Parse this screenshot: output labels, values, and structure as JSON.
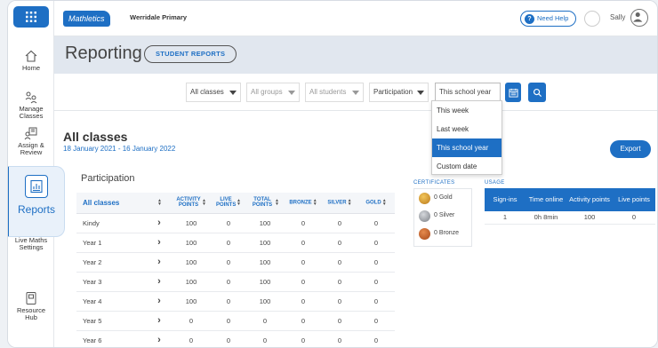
{
  "app": {
    "logo": "Mathletics",
    "school": "Werridale Primary",
    "need_help": "Need Help",
    "user": "Sally"
  },
  "sidebar": {
    "items": [
      {
        "label": "Home",
        "icon": "home-icon"
      },
      {
        "label": "Manage Classes",
        "icon": "manage-classes-icon"
      },
      {
        "label": "Assign & Review",
        "icon": "assign-review-icon"
      },
      {
        "label": "Reports",
        "icon": "reports-icon"
      },
      {
        "label": "Live Maths Settings",
        "icon": "live-maths-icon"
      },
      {
        "label": "Resource Hub",
        "icon": "resource-hub-icon"
      }
    ]
  },
  "header": {
    "title": "Reporting",
    "student_reports": "STUDENT REPORTS"
  },
  "filters": {
    "classes": "All classes",
    "groups": "All groups",
    "students": "All students",
    "type": "Participation",
    "period": "This school year"
  },
  "dropdown": {
    "options": [
      "This week",
      "Last week",
      "This school year",
      "Custom date"
    ],
    "selected": "This school year"
  },
  "summary": {
    "heading": "All classes",
    "date_range": "18 January 2021 - 16 January 2022",
    "export": "Export"
  },
  "participation": {
    "title": "Participation",
    "columns": [
      "All classes",
      "ACTIVITY POINTS",
      "LIVE POINTS",
      "TOTAL POINTS",
      "BRONZE",
      "SILVER",
      "GOLD"
    ],
    "rows": [
      {
        "name": "Kindy",
        "activity": "100",
        "live": "0",
        "total": "100",
        "bronze": "0",
        "silver": "0",
        "gold": "0"
      },
      {
        "name": "Year 1",
        "activity": "100",
        "live": "0",
        "total": "100",
        "bronze": "0",
        "silver": "0",
        "gold": "0"
      },
      {
        "name": "Year 2",
        "activity": "100",
        "live": "0",
        "total": "100",
        "bronze": "0",
        "silver": "0",
        "gold": "0"
      },
      {
        "name": "Year 3",
        "activity": "100",
        "live": "0",
        "total": "100",
        "bronze": "0",
        "silver": "0",
        "gold": "0"
      },
      {
        "name": "Year 4",
        "activity": "100",
        "live": "0",
        "total": "100",
        "bronze": "0",
        "silver": "0",
        "gold": "0"
      },
      {
        "name": "Year 5",
        "activity": "0",
        "live": "0",
        "total": "0",
        "bronze": "0",
        "silver": "0",
        "gold": "0"
      },
      {
        "name": "Year 6",
        "activity": "0",
        "live": "0",
        "total": "0",
        "bronze": "0",
        "silver": "0",
        "gold": "0"
      }
    ]
  },
  "certificates": {
    "label": "CERTIFICATES",
    "gold": "0 Gold",
    "silver": "0 Silver",
    "bronze": "0 Bronze"
  },
  "usage": {
    "label": "USAGE",
    "columns": [
      "Sign-ins",
      "Time online",
      "Activity points",
      "Live points"
    ],
    "row": [
      "1",
      "0h 8min",
      "100",
      "0"
    ]
  },
  "colors": {
    "accent": "#1e6fc4",
    "band": "#e1e7ef",
    "gold": "#d9a12a",
    "silver": "#9a9ea4",
    "bronze": "#c8652b"
  }
}
